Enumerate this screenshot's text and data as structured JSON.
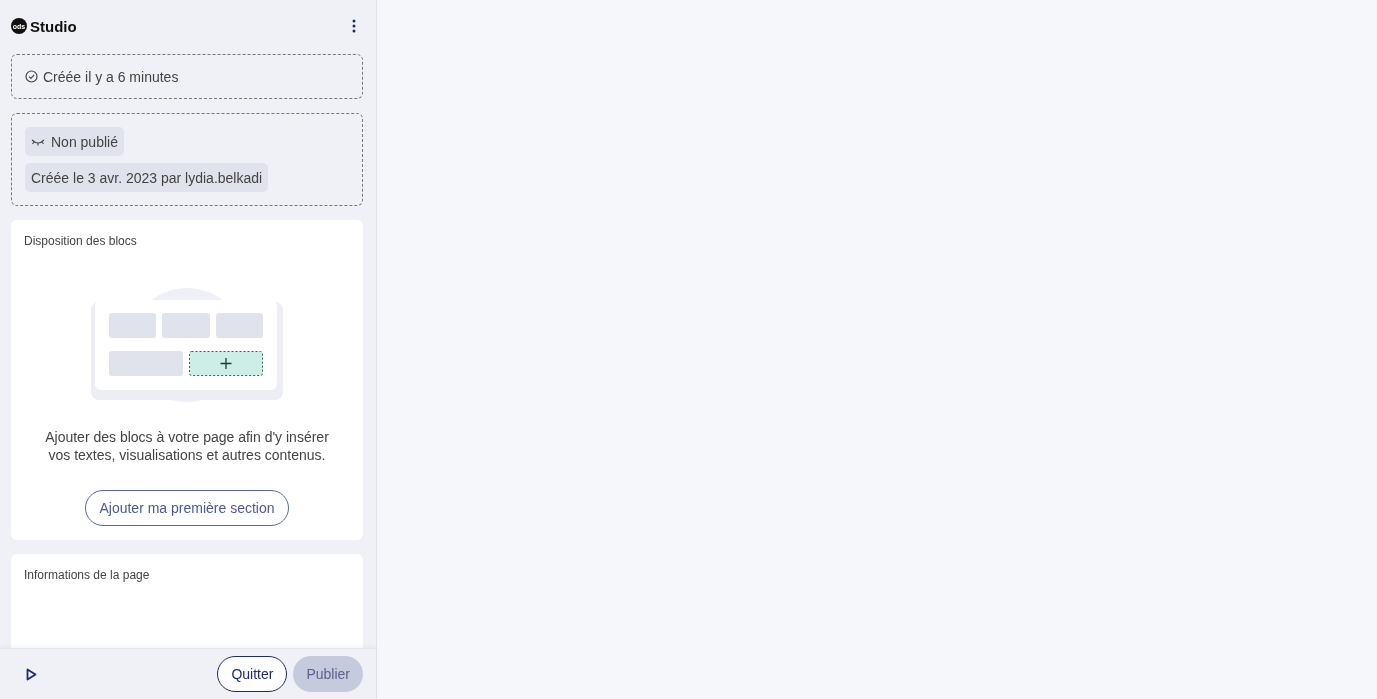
{
  "header": {
    "logo_text": "ods",
    "title": "Studio"
  },
  "created_status": {
    "text": "Créée il y a 6 minutes"
  },
  "publication": {
    "status": "Non publié",
    "published": false,
    "created_by": "Créée le 3 avr. 2023 par lydia.belkadi"
  },
  "sections": [
    {
      "title": "Disposition des blocs",
      "kind": "layout",
      "description": "Ajouter des blocs à votre page afin d'y insérer vos textes, visualisations et autres contenus.",
      "button": "Ajouter ma première section"
    },
    {
      "title": "Informations de la page",
      "kind": "info"
    }
  ],
  "footer": {
    "buttons": [
      {
        "label": "Quitter",
        "disabled": false,
        "kind": "outline"
      },
      {
        "label": "Publier",
        "disabled": true,
        "kind": "primary"
      }
    ]
  }
}
